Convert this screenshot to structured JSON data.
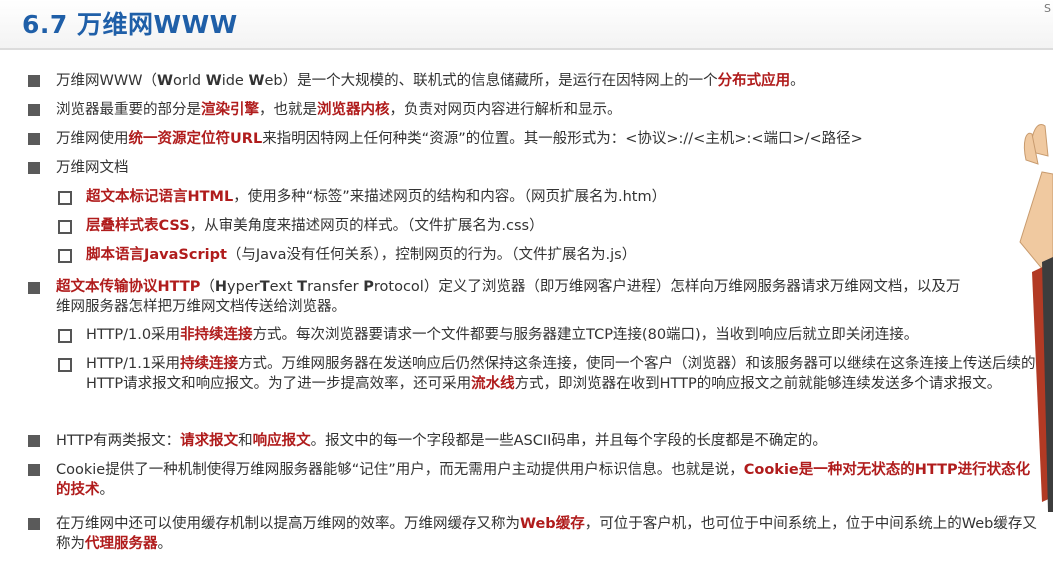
{
  "slide": {
    "title": "6.7 万维网WWW",
    "corner_mark": "S"
  },
  "items": [
    {
      "id": "b1",
      "segments": [
        {
          "t": "万维网WWW（"
        },
        {
          "t": "W",
          "b": true
        },
        {
          "t": "orld "
        },
        {
          "t": "W",
          "b": true
        },
        {
          "t": "ide "
        },
        {
          "t": "W",
          "b": true
        },
        {
          "t": "eb）是一个大规模的、联机式的信息储藏所，是运行在因特网上的一个"
        },
        {
          "t": "分布式应用",
          "hl": true
        },
        {
          "t": "。"
        }
      ]
    },
    {
      "id": "b2",
      "segments": [
        {
          "t": "浏览器最重要的部分是"
        },
        {
          "t": "渲染引擎",
          "hl": true
        },
        {
          "t": "，也就是"
        },
        {
          "t": "浏览器内核",
          "hl": true
        },
        {
          "t": "，负责对网页内容进行解析和显示。"
        }
      ]
    },
    {
      "id": "b3",
      "segments": [
        {
          "t": "万维网使用"
        },
        {
          "t": "统一资源定位符URL",
          "hl": true
        },
        {
          "t": "来指明因特网上任何种类“资源”的位置。其一般形式为：<协议>://<主机>:<端口>/<路径>"
        }
      ]
    },
    {
      "id": "b4",
      "segments": [
        {
          "t": "万维网文档"
        }
      ]
    },
    {
      "id": "s1",
      "segments": [
        {
          "t": "超文本标记语言HTML",
          "hl": true
        },
        {
          "t": "，使用多种“标签”来描述网页的结构和内容。（网页扩展名为.htm）"
        }
      ]
    },
    {
      "id": "s2",
      "segments": [
        {
          "t": "层叠样式表CSS",
          "hl": true
        },
        {
          "t": "，从审美角度来描述网页的样式。（文件扩展名为.css）"
        }
      ]
    },
    {
      "id": "s3",
      "segments": [
        {
          "t": "脚本语言JavaScript",
          "hl": true
        },
        {
          "t": "（与Java没有任何关系），控制网页的行为。（文件扩展名为.js）"
        }
      ]
    },
    {
      "id": "b5",
      "segments": [
        {
          "t": "超文本传输协议HTTP",
          "hl": true
        },
        {
          "t": "（"
        },
        {
          "t": "H",
          "b": true
        },
        {
          "t": "yper"
        },
        {
          "t": "T",
          "b": true
        },
        {
          "t": "ext "
        },
        {
          "t": "T",
          "b": true
        },
        {
          "t": "ransfer "
        },
        {
          "t": "P",
          "b": true
        },
        {
          "t": "rotocol）定义了浏览器（即万维网客户进程）怎样向万维网服务器请求万维网文档，以及万维网服务器怎样把万维网文档传送给浏览器。"
        }
      ]
    },
    {
      "id": "s4",
      "segments": [
        {
          "t": "HTTP/1.0采用"
        },
        {
          "t": "非持续连接",
          "hl": true
        },
        {
          "t": "方式。每次浏览器要请求一个文件都要与服务器建立TCP连接(80端口)，当收到响应后就立即关闭连接。"
        }
      ]
    },
    {
      "id": "s5",
      "segments": [
        {
          "t": "HTTP/1.1采用"
        },
        {
          "t": "持续连接",
          "hl": true
        },
        {
          "t": "方式。万维网服务器在发送响应后仍然保持这条连接，使同一个客户（浏览器）和该服务器可以继续在这条连接上传送后续的HTTP请求报文和响应报文。为了进一步提高效率，还可采用"
        },
        {
          "t": "流水线",
          "hl": true
        },
        {
          "t": "方式，即浏览器在收到HTTP的响应报文之前就能够连续发送多个请求报文。"
        }
      ]
    },
    {
      "id": "b6",
      "segments": [
        {
          "t": "HTTP有两类报文："
        },
        {
          "t": "请求报文",
          "hl": true
        },
        {
          "t": "和"
        },
        {
          "t": "响应报文",
          "hl": true
        },
        {
          "t": "。报文中的每一个字段都是一些ASCII码串，并且每个字段的长度都是不确定的。"
        }
      ]
    },
    {
      "id": "b7",
      "segments": [
        {
          "t": "Cookie提供了一种机制使得万维网服务器能够“记住”用户，而无需用户主动提供用户标识信息。也就是说，"
        },
        {
          "t": "Cookie是一种对无状态的HTTP进行状态化的技术",
          "hl": true
        },
        {
          "t": "。"
        }
      ]
    },
    {
      "id": "b8",
      "segments": [
        {
          "t": "在万维网中还可以使用缓存机制以提高万维网的效率。万维网缓存又称为"
        },
        {
          "t": "Web缓存",
          "hl": true
        },
        {
          "t": "，可位于客户机，也可位于中间系统上，位于中间系统上的Web缓存又称为"
        },
        {
          "t": "代理服务器",
          "hl": true
        },
        {
          "t": "。"
        }
      ]
    }
  ]
}
